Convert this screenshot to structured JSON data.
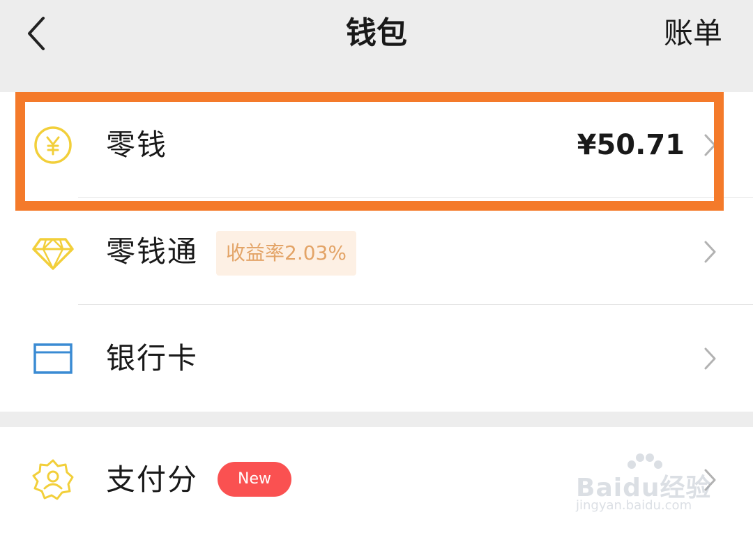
{
  "nav": {
    "title": "钱包",
    "bill_label": "账单"
  },
  "wallet_items": [
    {
      "label": "零钱",
      "amount": "¥50.71",
      "icon": "yuan-coin-icon"
    },
    {
      "label": "零钱通",
      "badge": "收益率2.03%",
      "icon": "diamond-icon"
    },
    {
      "label": "银行卡",
      "icon": "bank-card-icon"
    }
  ],
  "service_items": [
    {
      "label": "支付分",
      "badge": "New",
      "icon": "pay-score-icon"
    }
  ],
  "colors": {
    "highlight": "#f47a2a",
    "icon_yellow": "#f2cf3a",
    "card_blue": "#3a8bd3",
    "badge_red": "#fa5151",
    "rate_text": "#e3a467"
  },
  "watermark": {
    "main": "Baidu经验",
    "sub": "jingyan.baidu.com"
  }
}
